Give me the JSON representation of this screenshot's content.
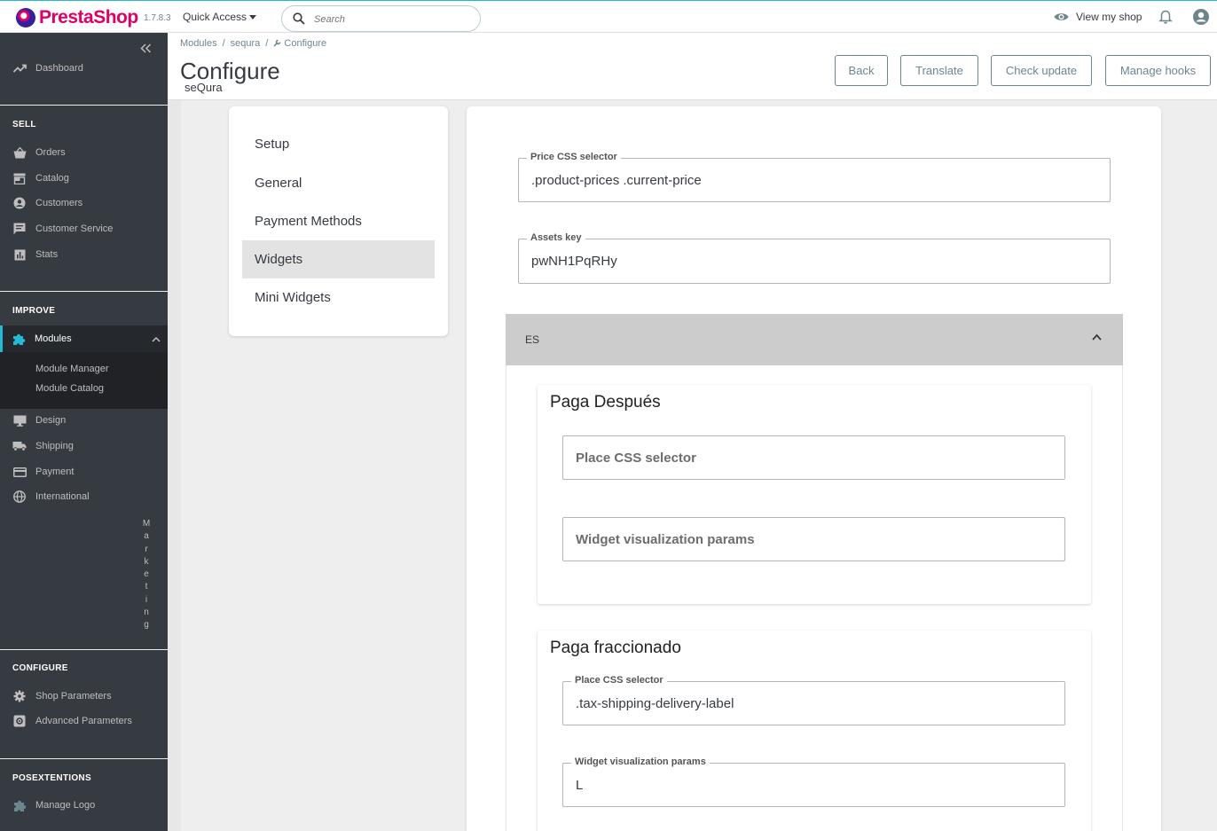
{
  "topbar": {
    "brand_name": "PrestaShop",
    "version": "1.7.8.3",
    "quick_access": "Quick Access",
    "search_placeholder": "Search",
    "view_my_shop": "View my shop"
  },
  "sidebar": {
    "dashboard": "Dashboard",
    "sell_title": "SELL",
    "sell_items": [
      "Orders",
      "Catalog",
      "Customers",
      "Customer Service",
      "Stats"
    ],
    "improve_title": "IMPROVE",
    "modules": "Modules",
    "modules_sub": [
      "Module Manager",
      "Module Catalog"
    ],
    "improve_items": [
      "Design",
      "Shipping",
      "Payment",
      "International"
    ],
    "marketing_vertical": "Marketing",
    "configure_title": "CONFIGURE",
    "configure_items": [
      "Shop Parameters",
      "Advanced Parameters"
    ],
    "posext_title": "POSEXTENTIONS",
    "posext_items": [
      "Manage Logo"
    ]
  },
  "header": {
    "breadcrumb": [
      "Modules",
      "sequra",
      "Configure"
    ],
    "title": "Configure",
    "subtitle": "seQura",
    "buttons": [
      "Back",
      "Translate",
      "Check update",
      "Manage hooks"
    ]
  },
  "menu": {
    "items": [
      "Setup",
      "General",
      "Payment Methods",
      "Widgets",
      "Mini Widgets"
    ],
    "active": "Widgets"
  },
  "form": {
    "price_selector_label": "Price CSS selector",
    "price_selector_value": ".product-prices  .current-price",
    "assets_key_label": "Assets key",
    "assets_key_value": "pwNH1PqRHy",
    "accordion_label": "ES",
    "paga_despues": {
      "title": "Paga Después",
      "place_placeholder": "Place CSS selector",
      "params_placeholder": "Widget visualization params"
    },
    "paga_fraccionado": {
      "title": "Paga fraccionado",
      "place_label": "Place CSS selector",
      "place_value": ".tax-shipping-delivery-label",
      "params_label": "Widget visualization params",
      "params_value": "L"
    }
  },
  "colors": {
    "sidebar_bg": "#363a41",
    "accent": "#25b9d7",
    "brand_pink": "#df0067"
  }
}
